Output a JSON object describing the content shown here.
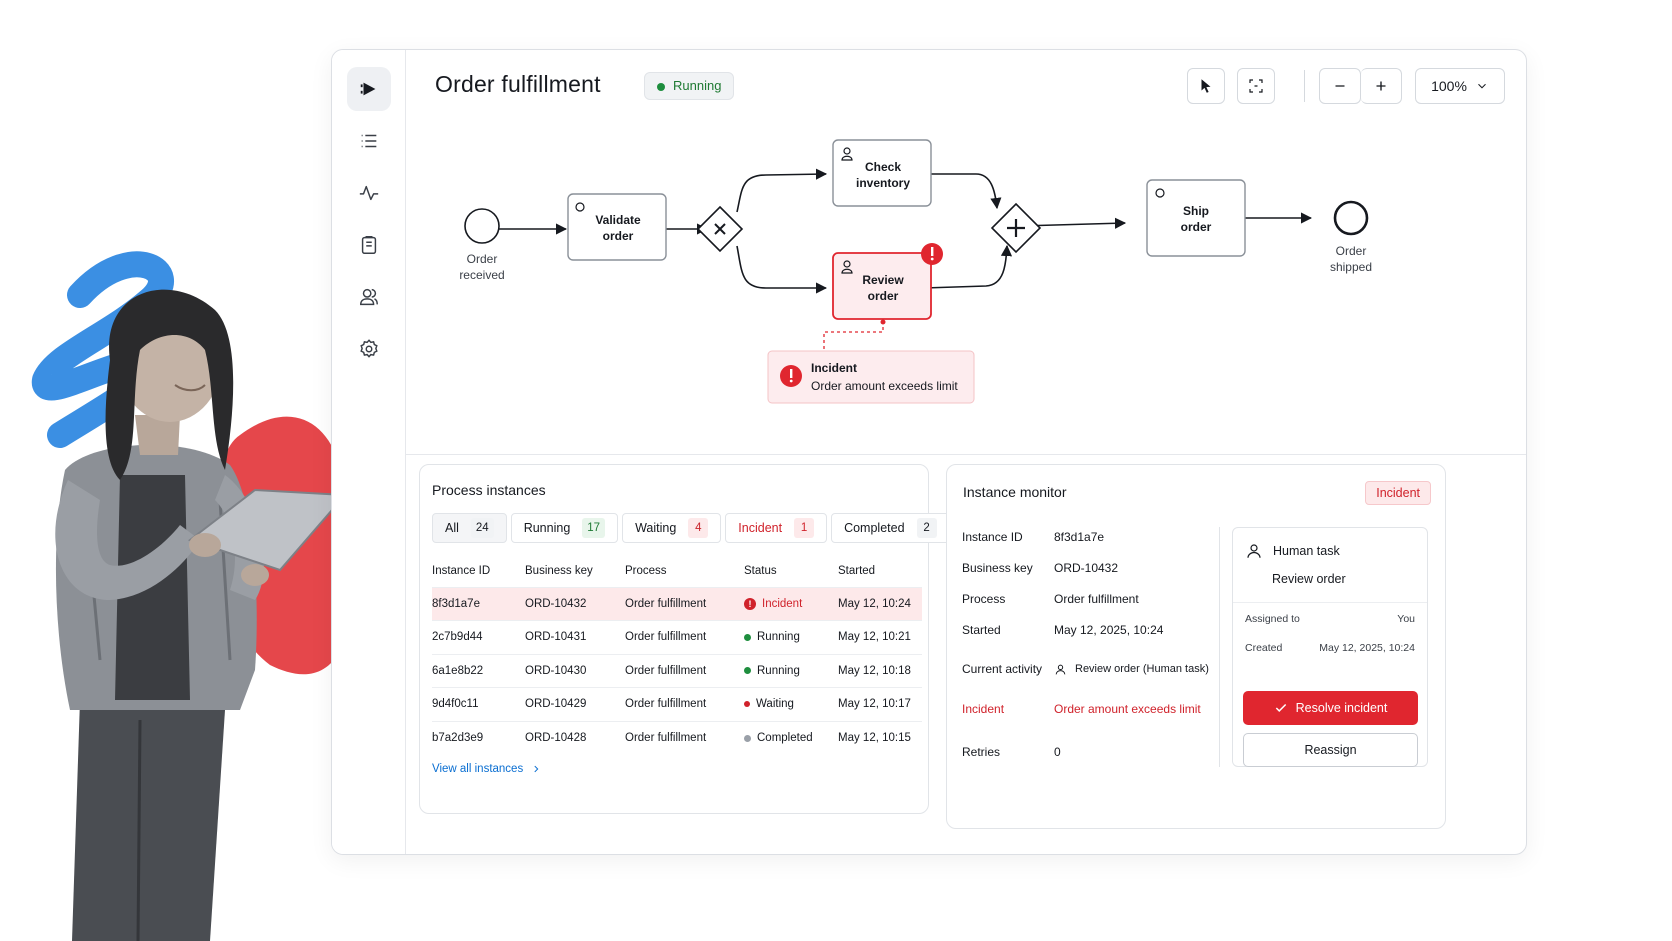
{
  "header": {
    "title": "Order fulfillment",
    "status": "Running",
    "zoom": "100%"
  },
  "toolbar": {
    "select_icon": "pointer-icon",
    "fit_icon": "fit-screen-icon",
    "zoom_out_icon": "minus-icon",
    "zoom_in_icon": "plus-icon"
  },
  "sidebar": {
    "items": [
      {
        "icon": "process-play-icon",
        "active": true
      },
      {
        "icon": "list-icon"
      },
      {
        "icon": "activity-icon"
      },
      {
        "icon": "tasks-icon"
      },
      {
        "icon": "users-icon"
      },
      {
        "icon": "settings-icon"
      }
    ]
  },
  "diagram": {
    "start_label_1": "Order",
    "start_label_2": "received",
    "validate_1": "Validate",
    "validate_2": "order",
    "check_1": "Check",
    "check_2": "inventory",
    "review_1": "Review",
    "review_2": "order",
    "ship_1": "Ship",
    "ship_2": "order",
    "end_label_1": "Order",
    "end_label_2": "shipped",
    "incident_title": "Incident",
    "incident_text": "Order amount exceeds limit"
  },
  "instances": {
    "title": "Process instances",
    "tabs": [
      {
        "label": "All",
        "count": "24"
      },
      {
        "label": "Running",
        "count": "17"
      },
      {
        "label": "Waiting",
        "count": "4"
      },
      {
        "label": "Incident",
        "count": "1"
      },
      {
        "label": "Completed",
        "count": "2"
      }
    ],
    "columns": [
      "Instance ID",
      "Business key",
      "Process",
      "Status",
      "Started"
    ],
    "rows": [
      {
        "id": "8f3d1a7e",
        "key": "ORD-10432",
        "process": "Order fulfillment",
        "status": "Incident",
        "started": "May 12, 10:24"
      },
      {
        "id": "2c7b9d44",
        "key": "ORD-10431",
        "process": "Order fulfillment",
        "status": "Running",
        "started": "May 12, 10:21"
      },
      {
        "id": "6a1e8b22",
        "key": "ORD-10430",
        "process": "Order fulfillment",
        "status": "Running",
        "started": "May 12, 10:18"
      },
      {
        "id": "9d4f0c11",
        "key": "ORD-10429",
        "process": "Order fulfillment",
        "status": "Waiting",
        "started": "May 12, 10:17"
      },
      {
        "id": "b7a2d3e9",
        "key": "ORD-10428",
        "process": "Order fulfillment",
        "status": "Completed",
        "started": "May 12, 10:15"
      }
    ],
    "view_all": "View all instances"
  },
  "monitor": {
    "title": "Instance monitor",
    "badge": "Incident",
    "fields": {
      "instance_id_label": "Instance ID",
      "instance_id": "8f3d1a7e",
      "business_key_label": "Business key",
      "business_key": "ORD-10432",
      "process_label": "Process",
      "process": "Order fulfillment",
      "started_label": "Started",
      "started": "May 12, 2025, 10:24",
      "current_activity_label": "Current activity",
      "current_activity": "Review order (Human task)",
      "incident_label": "Incident",
      "incident": "Order amount exceeds limit",
      "retries_label": "Retries",
      "retries": "0"
    },
    "task": {
      "heading": "Human task",
      "name": "Review order",
      "assigned_label": "Assigned to",
      "assigned": "You",
      "created_label": "Created",
      "created": "May 12, 2025, 10:24",
      "resolve": "Resolve incident",
      "reassign": "Reassign"
    }
  },
  "colors": {
    "accent_red": "#e0262f",
    "running_green": "#1e8e3e",
    "link_blue": "#0a6ed1",
    "brush_blue": "#3b8fe3"
  }
}
